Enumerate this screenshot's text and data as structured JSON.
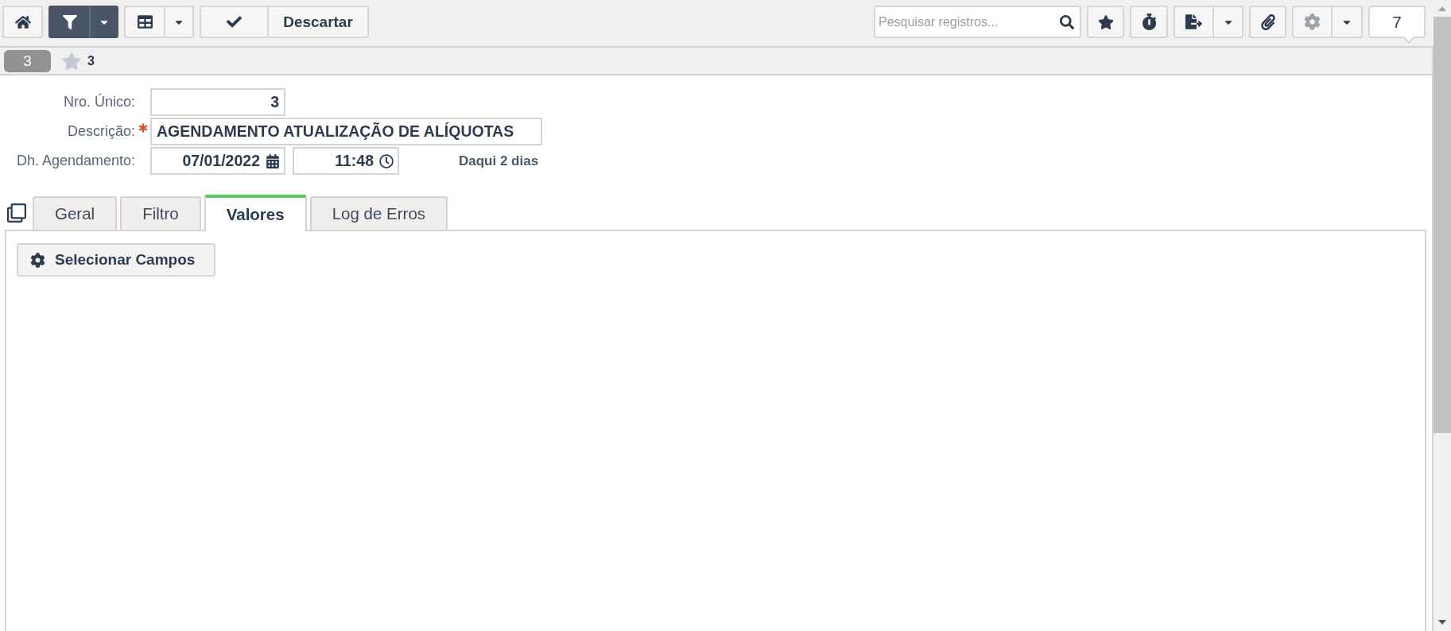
{
  "toolbar": {
    "filter": {
      "active": true
    },
    "discard_button": "Descartar",
    "search": {
      "placeholder": "Pesquisar registros..."
    },
    "settings": {
      "disabled": true
    },
    "record_counter": "7"
  },
  "record_bar": {
    "record_badge": "3",
    "favorite": {
      "starred": false,
      "count": "3"
    }
  },
  "form": {
    "fields": [
      {
        "kind": "number",
        "label": "Nro. Único:",
        "required": false,
        "value": "3"
      },
      {
        "kind": "text",
        "label": "Descrição:",
        "required": true,
        "value": "AGENDAMENTO ATUALIZAÇÃO DE ALÍQUOTAS"
      },
      {
        "kind": "datetime",
        "label": "Dh. Agendamento:",
        "required": false,
        "date": "07/01/2022",
        "time": "11:48",
        "hint": "Daqui 2 dias"
      }
    ]
  },
  "tabs": [
    {
      "label": "Geral",
      "selected": false
    },
    {
      "label": "Filtro",
      "selected": false
    },
    {
      "label": "Valores",
      "selected": true
    },
    {
      "label": "Log de Erros",
      "selected": false
    }
  ],
  "tab_panel": {
    "select_fields_button": "Selecionar Campos"
  }
}
